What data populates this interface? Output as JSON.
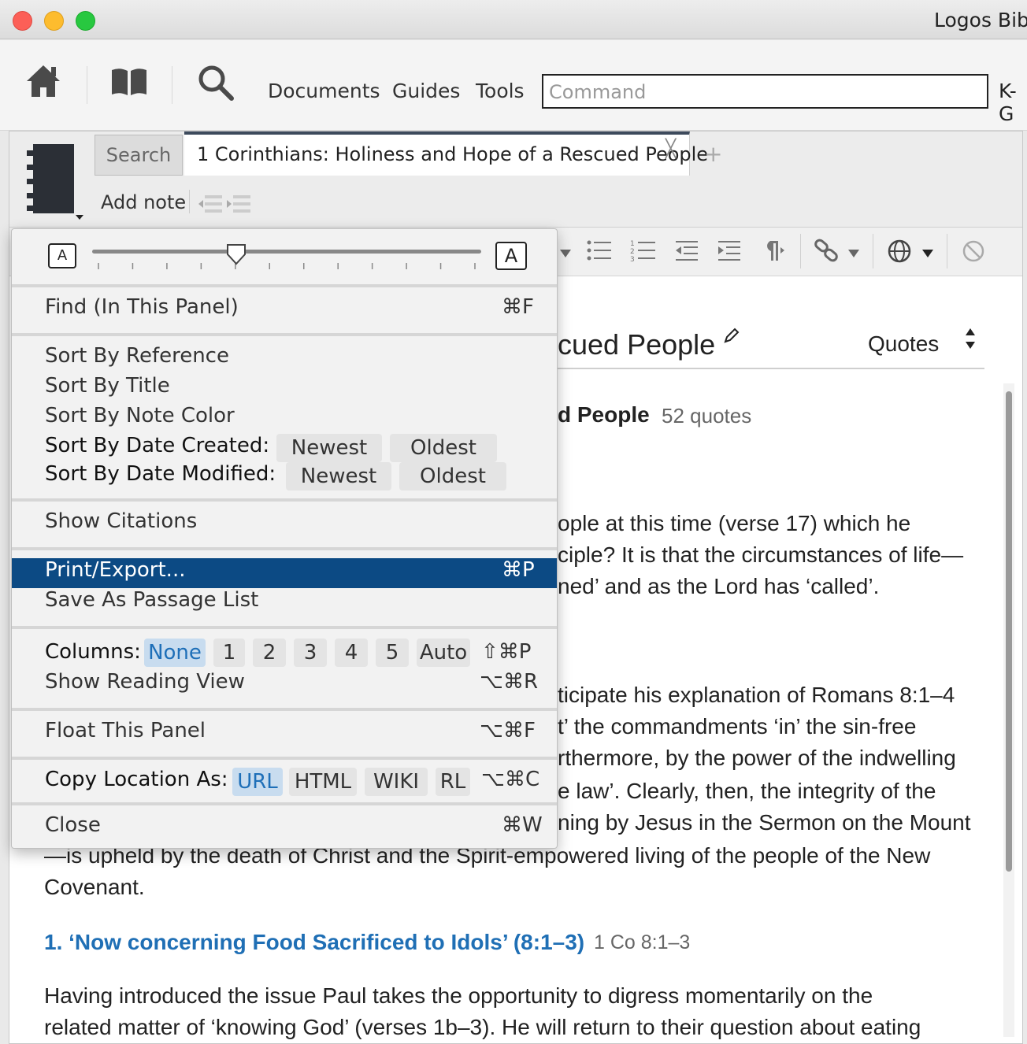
{
  "app": {
    "title": "Logos Bib"
  },
  "toolbar": {
    "nav_links": [
      "Documents",
      "Guides",
      "Tools"
    ],
    "command_placeholder": "Command",
    "right_label": "K-G"
  },
  "panel": {
    "tab_search": "Search",
    "tab_title": "1 Corinthians: Holiness and Hope of a Rescued People",
    "tab_close": "╳",
    "tab_add": "+",
    "add_note": "Add note"
  },
  "document": {
    "title_fragment": "cued People",
    "quotes_label": "Quotes",
    "heading_fragment": "d People",
    "quotes_count": "52 quotes",
    "lines_right": [
      "ople at this time (verse 17) which he",
      "ciple? It is that the circumstances of life—",
      "ned’ and as the Lord has ‘called’.",
      "ticipate his explanation of Romans 8:1–4",
      "t’ the commandments ‘in’ the sin-free",
      "rthermore, by the power of the indwelling",
      "e law’. Clearly, then, the integrity of the",
      "ning by Jesus in the Sermon on the Mount"
    ],
    "line_full_1": "—is upheld by the death of Christ and the Spirit-empowered living of the people of the New",
    "line_full_2": "Covenant.",
    "section_heading": "1. ‘Now concerning Food Sacrificed to Idols’ (8:1–3)",
    "section_ref": "1 Co 8:1–3",
    "para_1": "Having introduced the issue Paul takes the opportunity to digress momentarily on the",
    "para_2": "related matter of ‘knowing God’ (verses 1b–3). He will return to their question about eating"
  },
  "menu": {
    "font_small": "A",
    "font_large": "A",
    "find": "Find (In This Panel)",
    "find_sc": "⌘F",
    "sort_reference": "Sort By Reference",
    "sort_title": "Sort By Title",
    "sort_color": "Sort By Note Color",
    "sort_created": "Sort By Date Created:",
    "sort_modified": "Sort By Date Modified:",
    "newest": "Newest",
    "oldest": "Oldest",
    "show_citations": "Show Citations",
    "print_export": "Print/Export...",
    "print_sc": "⌘P",
    "save_passage": "Save As Passage List",
    "columns": "Columns:",
    "col_options": [
      "None",
      "1",
      "2",
      "3",
      "4",
      "5",
      "Auto"
    ],
    "columns_sc": "⇧⌘P",
    "reading_view": "Show Reading View",
    "reading_sc": "⌥⌘R",
    "float": "Float This Panel",
    "float_sc": "⌥⌘F",
    "copy_location": "Copy Location As:",
    "copy_options": [
      "URL",
      "HTML",
      "WIKI",
      "RL"
    ],
    "copy_sc": "⌥⌘C",
    "close": "Close",
    "close_sc": "⌘W"
  }
}
